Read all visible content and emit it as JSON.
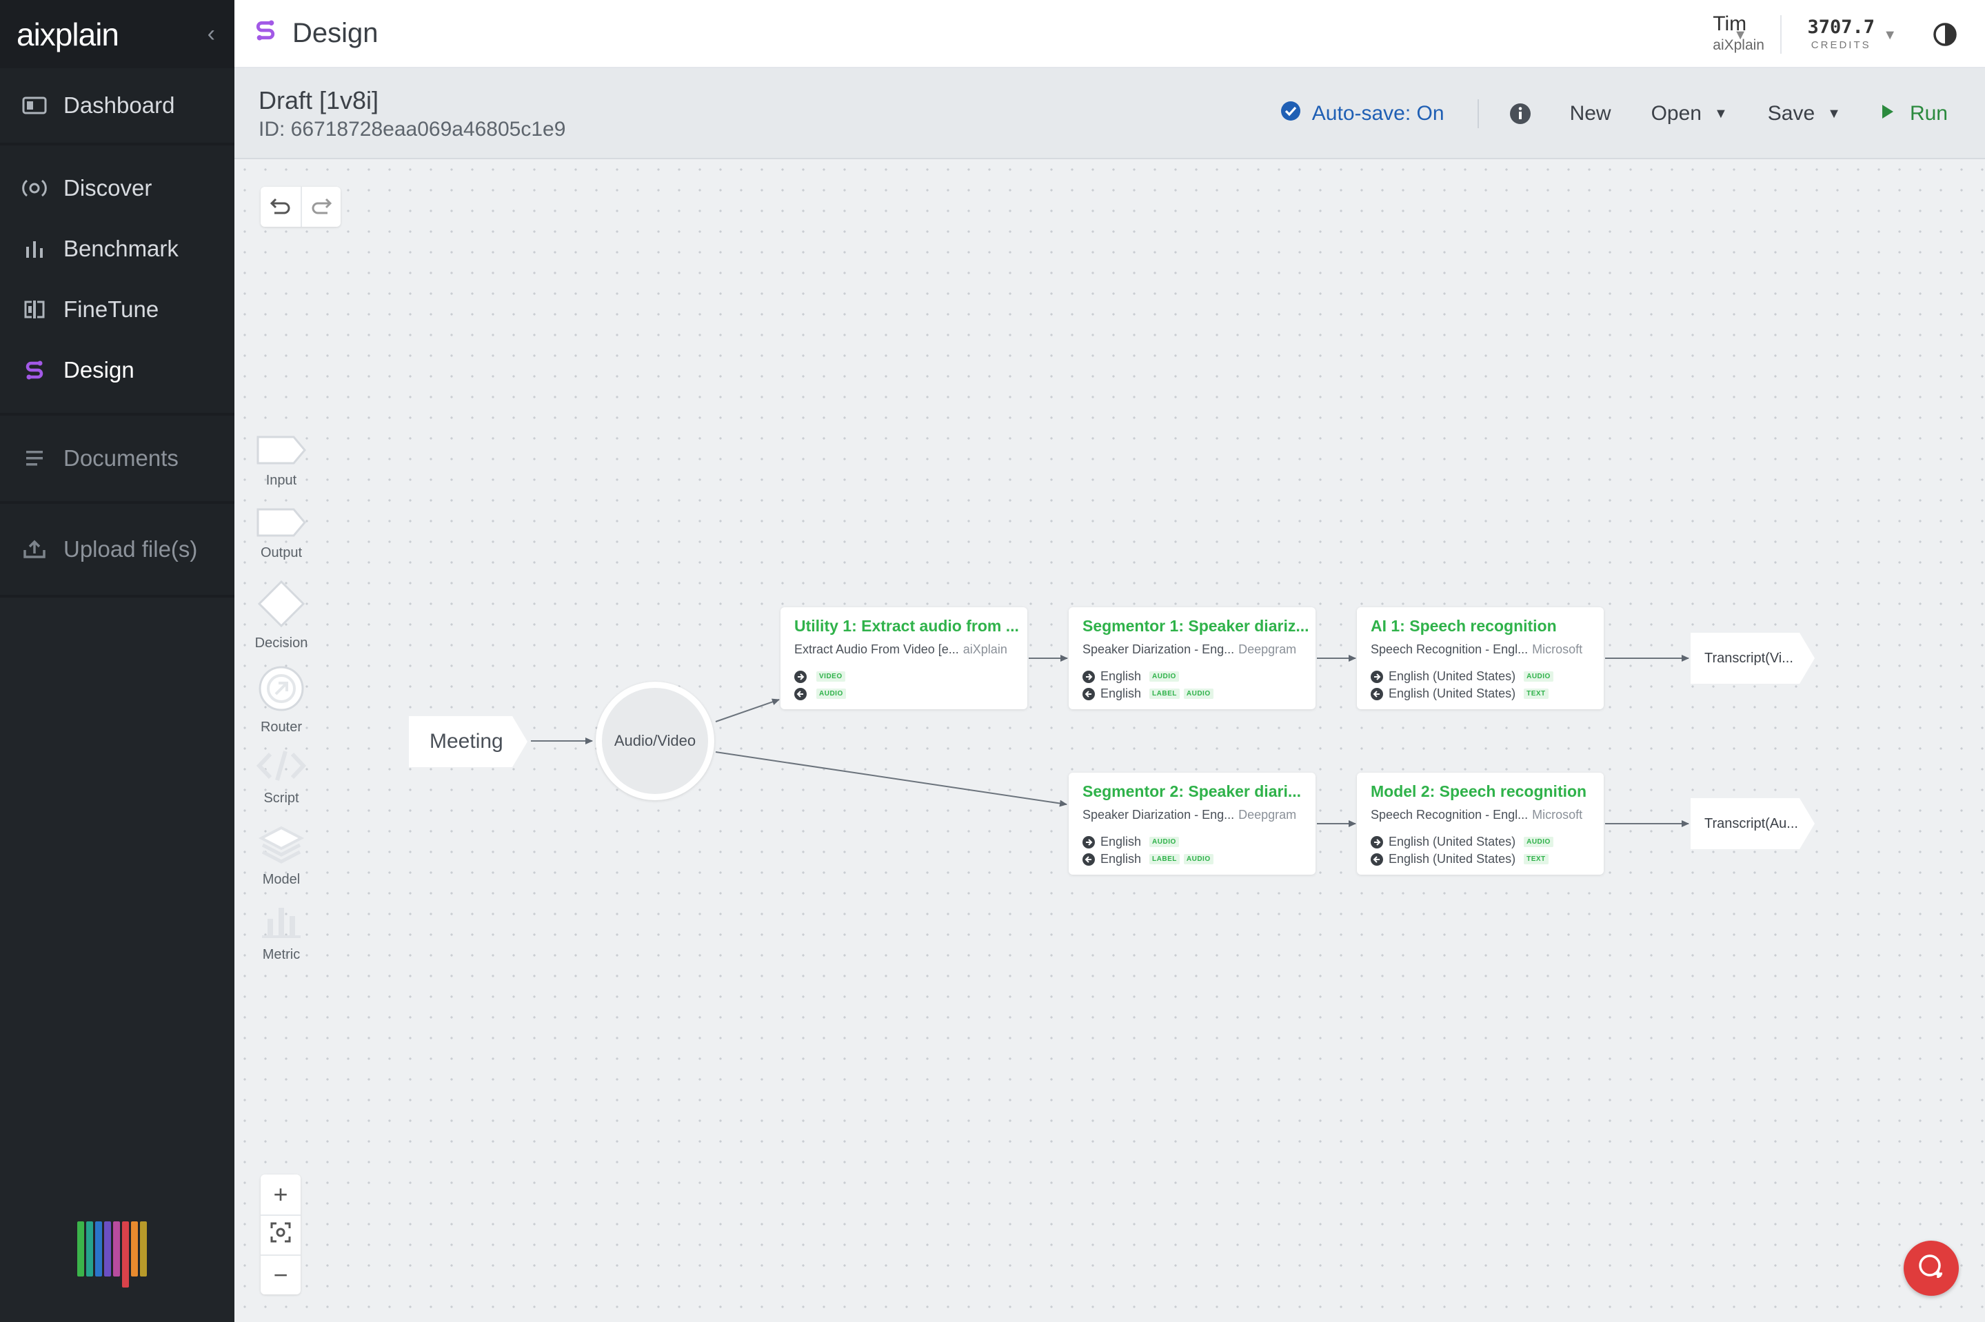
{
  "sidebar": {
    "logo": "aixplain",
    "nav": [
      {
        "label": "Dashboard",
        "icon": "dashboard-icon"
      },
      {
        "label": "Discover",
        "icon": "discover-icon"
      },
      {
        "label": "Benchmark",
        "icon": "benchmark-icon"
      },
      {
        "label": "FineTune",
        "icon": "finetune-icon"
      },
      {
        "label": "Design",
        "icon": "design-icon",
        "active": true
      },
      {
        "label": "Documents",
        "icon": "documents-icon"
      },
      {
        "label": "Upload file(s)",
        "icon": "upload-icon"
      }
    ]
  },
  "header": {
    "title": "Design",
    "user_name": "Tim",
    "user_org": "aiXplain",
    "credits_value": "3707.7",
    "credits_label": "CREDITS"
  },
  "toolbar": {
    "draft_title": "Draft [1v8i]",
    "draft_id": "ID: 66718728eaa069a46805c1e9",
    "autosave": "Auto-save: On",
    "new_label": "New",
    "open_label": "Open",
    "save_label": "Save",
    "run_label": "Run"
  },
  "palette": [
    {
      "label": "Input",
      "icon": "input-node-icon"
    },
    {
      "label": "Output",
      "icon": "output-node-icon"
    },
    {
      "label": "Decision",
      "icon": "decision-node-icon"
    },
    {
      "label": "Router",
      "icon": "router-node-icon"
    },
    {
      "label": "Script",
      "icon": "script-node-icon"
    },
    {
      "label": "Model",
      "icon": "model-node-icon"
    },
    {
      "label": "Metric",
      "icon": "metric-node-icon"
    }
  ],
  "flow": {
    "input_node": "Meeting",
    "av_node": "Audio/Video",
    "cards": [
      {
        "title": "Utility 1: Extract audio from ...",
        "subtitle": "Extract Audio From Video [e...",
        "provider": "aiXplain",
        "io": [
          {
            "dir": "in",
            "lang": "",
            "tags": [
              "VIDEO"
            ]
          },
          {
            "dir": "out",
            "lang": "",
            "tags": [
              "AUDIO"
            ]
          }
        ]
      },
      {
        "title": "Segmentor 1: Speaker diariz...",
        "subtitle": "Speaker Diarization - Eng...",
        "provider": "Deepgram",
        "io": [
          {
            "dir": "in",
            "lang": "English",
            "tags": [
              "AUDIO"
            ]
          },
          {
            "dir": "out",
            "lang": "English",
            "tags": [
              "LABEL",
              "AUDIO"
            ]
          }
        ]
      },
      {
        "title": "AI 1: Speech recognition",
        "subtitle": "Speech Recognition - Engl...",
        "provider": "Microsoft",
        "io": [
          {
            "dir": "in",
            "lang": "English (United States)",
            "tags": [
              "AUDIO"
            ]
          },
          {
            "dir": "out",
            "lang": "English (United States)",
            "tags": [
              "TEXT"
            ]
          }
        ]
      },
      {
        "title": "Segmentor 2: Speaker diari...",
        "subtitle": "Speaker Diarization - Eng...",
        "provider": "Deepgram",
        "io": [
          {
            "dir": "in",
            "lang": "English",
            "tags": [
              "AUDIO"
            ]
          },
          {
            "dir": "out",
            "lang": "English",
            "tags": [
              "LABEL",
              "AUDIO"
            ]
          }
        ]
      },
      {
        "title": "Model 2: Speech recognition",
        "subtitle": "Speech Recognition - Engl...",
        "provider": "Microsoft",
        "io": [
          {
            "dir": "in",
            "lang": "English (United States)",
            "tags": [
              "AUDIO"
            ]
          },
          {
            "dir": "out",
            "lang": "English (United States)",
            "tags": [
              "TEXT"
            ]
          }
        ]
      }
    ],
    "outputs": [
      "Transcript(Vi...",
      "Transcript(Au..."
    ]
  },
  "colors": {
    "sidebar_bg": "#212529",
    "accent_green": "#2fb24a",
    "autosave_blue": "#1f5fb4",
    "run_green": "#2b8a3e",
    "design_purple": "#a259e6",
    "help_red": "#e03c3c"
  }
}
